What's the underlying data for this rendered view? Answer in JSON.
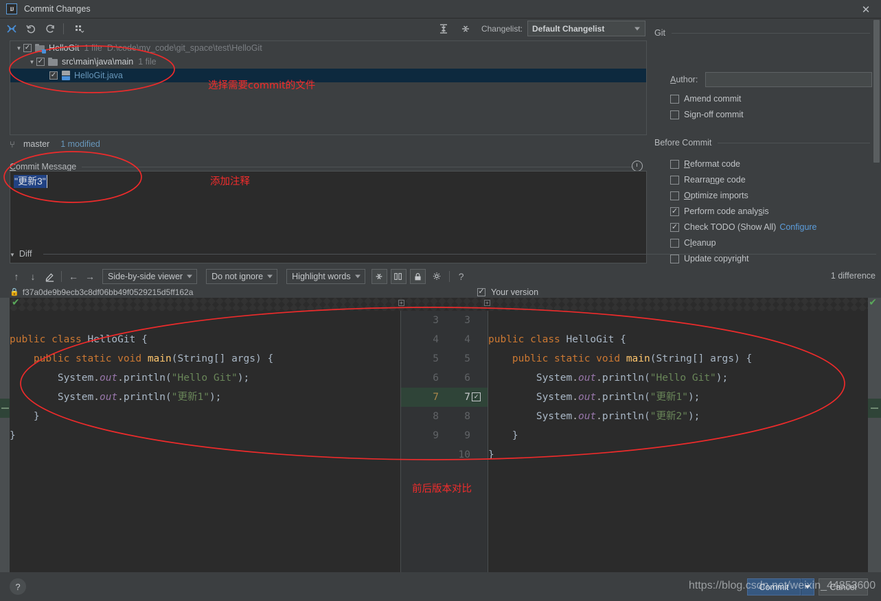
{
  "window": {
    "title": "Commit Changes",
    "logo": "IJ",
    "close_icon": "close-icon"
  },
  "toolbar": {
    "icons": [
      {
        "name": "collapse-all-icon",
        "glyph": "⤮"
      },
      {
        "name": "rollback-icon",
        "glyph": "↺"
      },
      {
        "name": "refresh-icon",
        "glyph": "⟳"
      },
      {
        "name": "group-by-icon",
        "glyph": "⁙"
      }
    ],
    "expand_all_icon": "expand-all-icon",
    "collapse_all_icon": "collapse-all-icon",
    "changelist_label": "Changelist:",
    "changelist_value": "Default Changelist"
  },
  "tree": {
    "rows": [
      {
        "indent": 0,
        "twisty": "▼",
        "checked": true,
        "icon": "vcs-folder-icon",
        "name": "HelloGit",
        "dim1": "1 file",
        "dim2": "D:\\code\\my_code\\git_space\\test\\HelloGit",
        "selected": false,
        "modified": false
      },
      {
        "indent": 1,
        "twisty": "▼",
        "checked": true,
        "icon": "folder-icon",
        "name": "src\\main\\java\\main",
        "dim1": "1 file",
        "dim2": "",
        "selected": false,
        "modified": false
      },
      {
        "indent": 2,
        "twisty": "",
        "checked": true,
        "icon": "java-file-icon",
        "name": "HelloGit.java",
        "dim1": "",
        "dim2": "",
        "selected": true,
        "modified": true
      }
    ]
  },
  "branch_bar": {
    "branch_icon": "branch-icon",
    "branch": "master",
    "modified": "1 modified"
  },
  "commit_message": {
    "section_title": "Commit Message",
    "underline_char": "C",
    "value": "\"更新3\"",
    "history_icon": "history-clock-icon"
  },
  "git_panel": {
    "section_title": "Git",
    "author_label": "Author:",
    "author_value": "",
    "checkboxes": [
      {
        "label": "Amend commit",
        "checked": false
      },
      {
        "label": "Sign-off commit",
        "checked": false
      }
    ]
  },
  "before_commit": {
    "section_title": "Before Commit",
    "checkboxes": [
      {
        "label": "Reformat code",
        "checked": false,
        "link": ""
      },
      {
        "label": "Rearrange code",
        "checked": false,
        "link": ""
      },
      {
        "label": "Optimize imports",
        "checked": false,
        "link": ""
      },
      {
        "label": "Perform code analysis",
        "checked": true,
        "link": ""
      },
      {
        "label": "Check TODO (Show All)",
        "checked": true,
        "link": "Configure"
      },
      {
        "label": "Cleanup",
        "checked": false,
        "link": ""
      },
      {
        "label": "Update copyright",
        "checked": false,
        "link": ""
      }
    ]
  },
  "diff": {
    "section_title": "Diff",
    "twisty": "▼",
    "toolbar": {
      "prev_diff_icon": "arrow-up-icon",
      "next_diff_icon": "arrow-down-icon",
      "edit_icon": "pencil-icon",
      "accept_left_icon": "arrow-left-icon",
      "accept_right_icon": "arrow-right-icon",
      "viewer_mode": "Side-by-side viewer",
      "ignore_mode": "Do not ignore",
      "highlight_mode": "Highlight words",
      "collapse_unchanged_icon": "collapse-lines-icon",
      "columns_icon": "two-columns-icon",
      "readonly_icon": "lock-icon",
      "settings_icon": "gear-icon",
      "help_icon": "question-icon"
    },
    "difference_count": "1 difference",
    "revision_lock_icon": "lock-icon",
    "revision_hash": "f37a0de9b9ecb3c8df06bb49f0529215d5ff162a",
    "your_version_label": "Your version",
    "your_version_checked": true,
    "left_lines": [
      "public class HelloGit {",
      "    public static void main(String[] args) {",
      "        System.out.println(\"Hello Git\");",
      "        System.out.println(\"更新1\");",
      "    }",
      "}"
    ],
    "right_lines": [
      "public class HelloGit {",
      "    public static void main(String[] args) {",
      "        System.out.println(\"Hello Git\");",
      "        System.out.println(\"更新1\");",
      "        System.out.println(\"更新2\");",
      "    }",
      "}"
    ],
    "left_numbers": [
      "3",
      "4",
      "5",
      "6",
      "7",
      "8",
      "9"
    ],
    "right_numbers": [
      "3",
      "4",
      "5",
      "6",
      "7",
      "8",
      "9",
      "10"
    ],
    "highlight_row_index": 4,
    "accept_change_icon": "accept-change-checkbox"
  },
  "footer": {
    "help_icon": "question-icon",
    "commit_label": "Commit",
    "commit_dropdown_icon": "chevron-down-icon",
    "cancel_label": "Cancel",
    "watermark": "https://blog.csdn.net/weixin_44853600"
  },
  "annotations": [
    {
      "text": "选择需要commit的文件",
      "name": "annotation-select-files"
    },
    {
      "text": "添加注释",
      "name": "annotation-add-message"
    },
    {
      "text": "前后版本对比",
      "name": "annotation-version-compare"
    }
  ],
  "colors": {
    "accent_blue": "#4a90d9",
    "link_blue": "#5c9ddb",
    "annotation_red": "#ee2b2b",
    "selection_blue": "#0d293e",
    "diff_green": "#2f4438",
    "keyword_orange": "#cc7832",
    "string_green": "#6a8759",
    "field_purple": "#9876aa",
    "method_yellow": "#ffc66d"
  }
}
